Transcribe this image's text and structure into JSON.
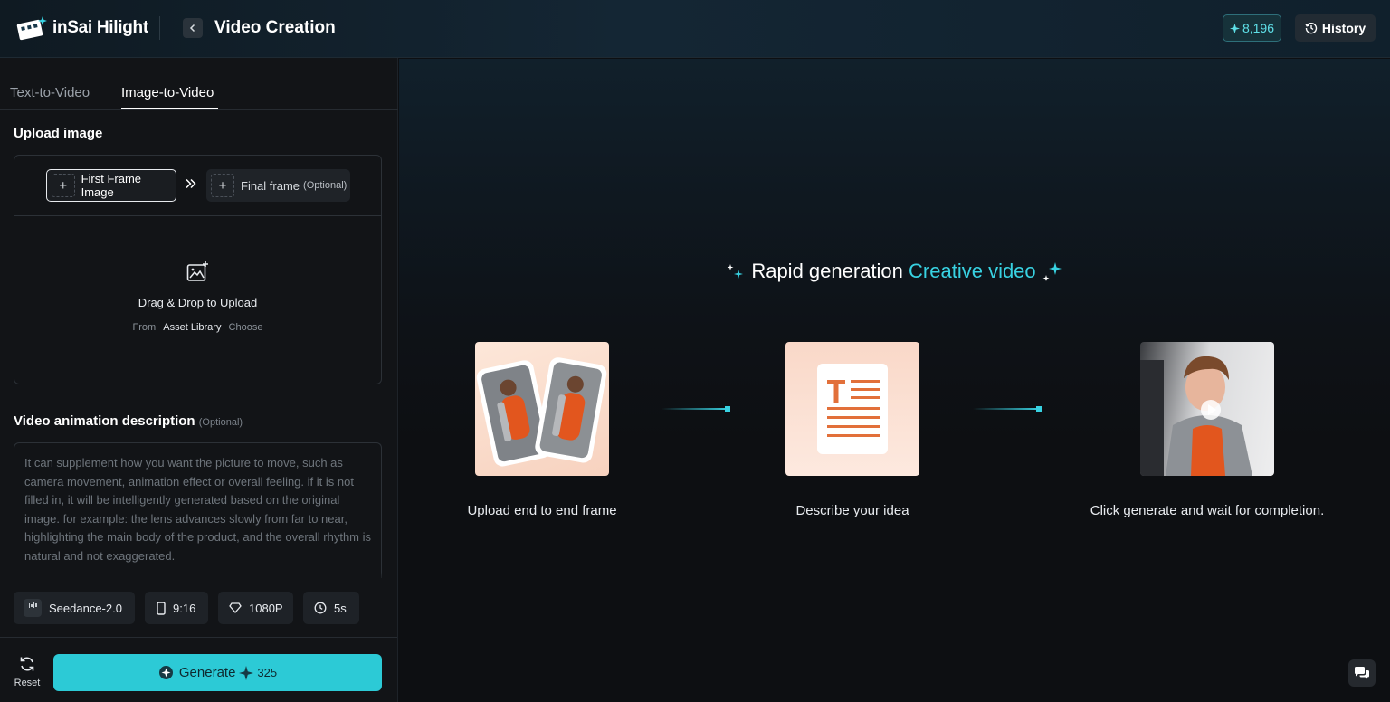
{
  "header": {
    "brand": "inSai Hilight",
    "title": "Video Creation",
    "credits": "8,196",
    "history_label": "History"
  },
  "tabs": [
    {
      "label": "Text-to-Video",
      "active": false
    },
    {
      "label": "Image-to-Video",
      "active": true
    }
  ],
  "upload": {
    "section_label": "Upload image",
    "first_frame_label": "First Frame Image",
    "final_frame_label": "Final frame",
    "final_frame_optional": "(Optional)",
    "drop_title": "Drag & Drop to Upload",
    "from_label": "From",
    "asset_library_label": "Asset Library",
    "choose_label": "Choose"
  },
  "description": {
    "section_label": "Video animation description",
    "optional_label": "(Optional)",
    "placeholder": "It can supplement how you want the picture to move, such as camera movement, animation effect or overall feeling. if it is not filled in, it will be intelligently generated based on the original image. for example: the lens advances slowly from far to near, highlighting the main body of the product, and the overall rhythm is natural and not exaggerated."
  },
  "params": {
    "model": "Seedance-2.0",
    "aspect_ratio": "9:16",
    "resolution": "1080P",
    "duration": "5s"
  },
  "actions": {
    "reset_label": "Reset",
    "generate_label": "Generate",
    "generate_cost": "325"
  },
  "hero": {
    "title_prefix": "Rapid generation",
    "title_accent": "Creative video"
  },
  "steps": [
    {
      "label": "Upload end to end frame"
    },
    {
      "label": "Describe your idea"
    },
    {
      "label": "Click generate and wait for completion."
    }
  ],
  "colors": {
    "accent": "#38d2e2",
    "generate_button": "#2ccad6",
    "background": "#0d0f12",
    "panel": "#121417"
  },
  "icons": {
    "back": "chevron-left-icon",
    "credits": "sparkle-icon",
    "history": "clock-history-icon",
    "upload": "image-plus-icon",
    "model": "bars-icon",
    "aspect": "phone-icon",
    "resolution": "diamond-icon",
    "duration": "clock-icon",
    "reset": "refresh-icon",
    "chat": "chat-bubbles-icon"
  }
}
